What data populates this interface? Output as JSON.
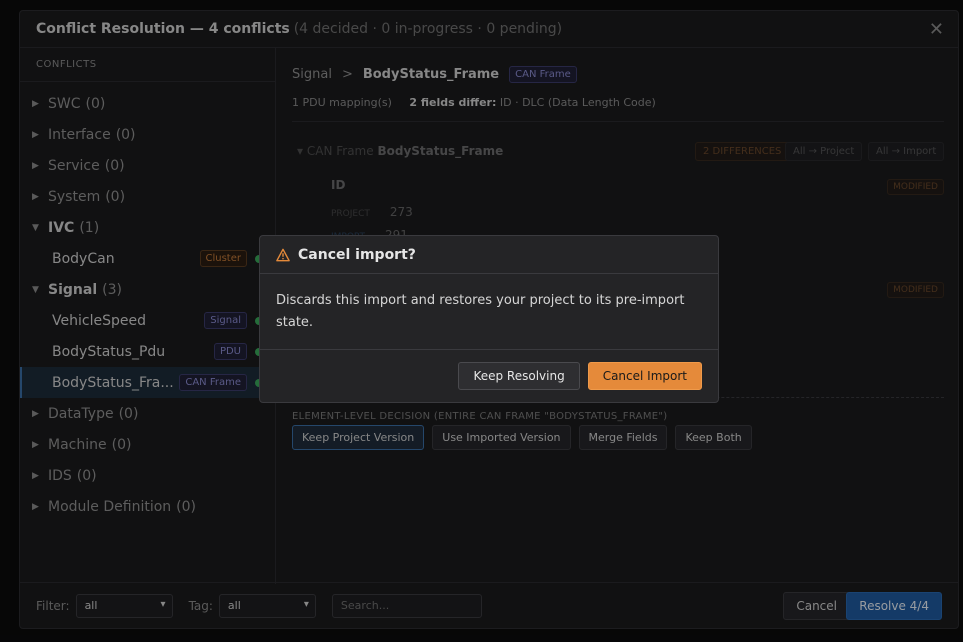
{
  "title": {
    "main": "Conflict Resolution — 4 conflicts",
    "sub": "(4 decided · 0 in-progress · 0 pending)"
  },
  "sidebar": {
    "heading": "CONFLICTS",
    "groups": [
      {
        "label": "SWC",
        "count": "(0)"
      },
      {
        "label": "Interface",
        "count": "(0)"
      },
      {
        "label": "Service",
        "count": "(0)"
      },
      {
        "label": "System",
        "count": "(0)"
      },
      {
        "label": "IVC",
        "count": "(1)"
      },
      {
        "label": "Signal",
        "count": "(3)"
      },
      {
        "label": "DataType",
        "count": "(0)"
      },
      {
        "label": "Machine",
        "count": "(0)"
      },
      {
        "label": "IDS",
        "count": "(0)"
      },
      {
        "label": "Module Definition",
        "count": "(0)"
      }
    ],
    "children": [
      {
        "label": "BodyCan",
        "tag": "Cluster"
      },
      {
        "label": "VehicleSpeed",
        "tag": "Signal"
      },
      {
        "label": "BodyStatus_Pdu",
        "tag": "PDU"
      },
      {
        "label": "BodyStatus_Fra...",
        "tag": "CAN Frame"
      }
    ]
  },
  "main": {
    "breadcrumb": {
      "root": "Signal",
      "sep": ">",
      "leaf": "BodyStatus_Frame",
      "tag": "CAN Frame"
    },
    "meta": {
      "mapping": "1 PDU mapping(s)",
      "differ": "2 fields differ:",
      "fields": "ID · DLC (Data Length Code)"
    },
    "frame": {
      "caret": "▾",
      "kind": "CAN Frame",
      "name": "BodyStatus_Frame",
      "diffs": "2 DIFFERENCES",
      "all_project": "All → Project",
      "all_import": "All → Import"
    },
    "field": {
      "name": "ID",
      "modified": "MODIFIED",
      "project_label": "PROJECT",
      "project_value": "273",
      "import_label": "IMPORT",
      "import_value": "291"
    },
    "modified2": "MODIFIED",
    "decision_label": "ELEMENT-LEVEL DECISION (ENTIRE CAN FRAME \"BODYSTATUS_FRAME\")",
    "decisions": [
      "Keep Project Version",
      "Use Imported Version",
      "Merge Fields",
      "Keep Both"
    ]
  },
  "footer": {
    "filter_label": "Filter:",
    "filter_value": "all",
    "tag_label": "Tag:",
    "tag_value": "all",
    "search_placeholder": "Search...",
    "cancel": "Cancel",
    "resolve": "Resolve 4/4"
  },
  "dialog": {
    "title": "Cancel import?",
    "body": "Discards this import and restores your project to its pre-import state.",
    "keep": "Keep Resolving",
    "cancel": "Cancel Import"
  }
}
